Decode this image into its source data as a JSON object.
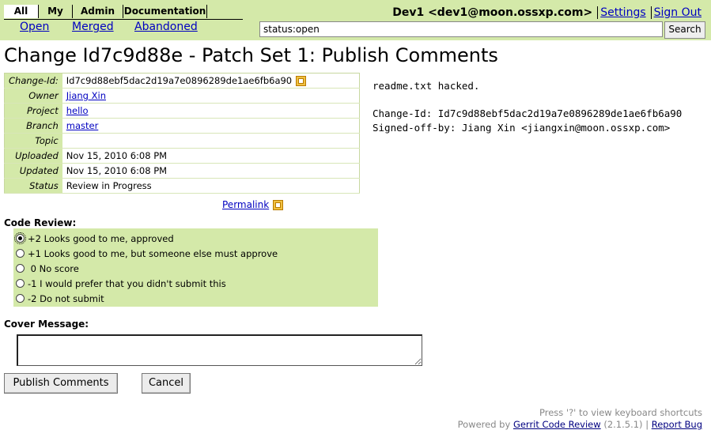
{
  "nav": {
    "tabs": [
      {
        "label": "All"
      },
      {
        "label": "My"
      },
      {
        "label": "Admin"
      },
      {
        "label": "Documentation"
      }
    ],
    "subtabs": [
      {
        "label": "Open"
      },
      {
        "label": "Merged"
      },
      {
        "label": "Abandoned"
      }
    ]
  },
  "user": {
    "name": "Dev1 <dev1@moon.ossxp.com>",
    "settings_label": "Settings",
    "signout_label": "Sign Out"
  },
  "search": {
    "value": "status:open",
    "button_label": "Search"
  },
  "page": {
    "title": "Change Id7c9d88e - Patch Set 1: Publish Comments"
  },
  "info": {
    "rows": [
      {
        "label": "Change-Id:",
        "value": "Id7c9d88ebf5dac2d19a7e0896289de1ae6fb6a90"
      },
      {
        "label": "Owner",
        "value": "Jiang Xin"
      },
      {
        "label": "Project",
        "value": "hello"
      },
      {
        "label": "Branch",
        "value": "master"
      },
      {
        "label": "Topic",
        "value": ""
      },
      {
        "label": "Uploaded",
        "value": "Nov 15, 2010 6:08 PM"
      },
      {
        "label": "Updated",
        "value": "Nov 15, 2010 6:08 PM"
      },
      {
        "label": "Status",
        "value": "Review in Progress"
      }
    ],
    "permalink_label": "Permalink"
  },
  "commit_message": "readme.txt hacked.\n\nChange-Id: Id7c9d88ebf5dac2d19a7e0896289de1ae6fb6a90\nSigned-off-by: Jiang Xin <jiangxin@moon.ossxp.com>",
  "review": {
    "label": "Code Review:",
    "options": [
      {
        "label": "+2 Looks good to me, approved",
        "checked": true
      },
      {
        "label": "+1 Looks good to me, but someone else must approve",
        "checked": false
      },
      {
        "label": " 0 No score",
        "checked": false
      },
      {
        "label": "-1 I would prefer that you didn't submit this",
        "checked": false
      },
      {
        "label": "-2 Do not submit",
        "checked": false
      }
    ]
  },
  "cover": {
    "label": "Cover Message:",
    "value": ""
  },
  "actions": {
    "publish_label": "Publish Comments",
    "cancel_label": "Cancel"
  },
  "footer": {
    "shortcuts_hint": "Press '?' to view keyboard shortcuts",
    "powered_by": "Powered by",
    "gerrit_link": "Gerrit Code Review",
    "version": "(2.1.5.1)",
    "separator": "|",
    "report_bug": "Report Bug"
  }
}
